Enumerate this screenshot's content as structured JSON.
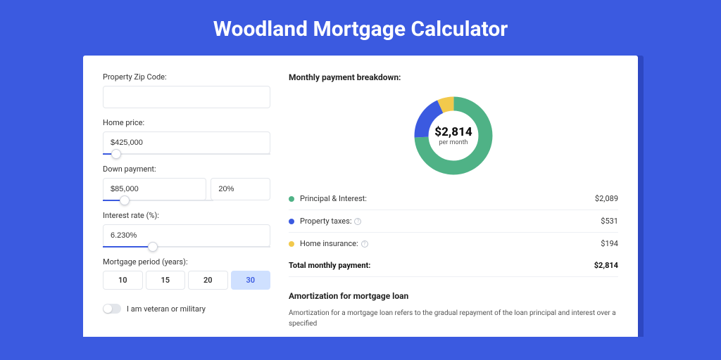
{
  "title": "Woodland Mortgage Calculator",
  "form": {
    "zip": {
      "label": "Property Zip Code:",
      "value": ""
    },
    "homePrice": {
      "label": "Home price:",
      "value": "$425,000",
      "sliderPct": 8
    },
    "downPayment": {
      "label": "Down payment:",
      "amount": "$85,000",
      "percent": "20%",
      "sliderPct": 20
    },
    "interestRate": {
      "label": "Interest rate (%):",
      "value": "6.230%",
      "sliderPct": 30
    },
    "mortgagePeriod": {
      "label": "Mortgage period (years):",
      "options": [
        "10",
        "15",
        "20",
        "30"
      ],
      "selected": "30"
    },
    "veteran": {
      "label": "I am veteran or military",
      "on": false
    }
  },
  "breakdown": {
    "title": "Monthly payment breakdown:",
    "amount": "$2,814",
    "sub": "per month",
    "items": [
      {
        "label": "Principal & Interest:",
        "value": "$2,089",
        "color": "#4fb286",
        "help": false
      },
      {
        "label": "Property taxes:",
        "value": "$531",
        "color": "#3b5ae0",
        "help": true
      },
      {
        "label": "Home insurance:",
        "value": "$194",
        "color": "#f2c94c",
        "help": true
      }
    ],
    "totalLabel": "Total monthly payment:",
    "totalValue": "$2,814"
  },
  "amortization": {
    "title": "Amortization for mortgage loan",
    "body": "Amortization for a mortgage loan refers to the gradual repayment of the loan principal and interest over a specified"
  },
  "chart_data": {
    "type": "pie",
    "title": "Monthly payment breakdown",
    "categories": [
      "Principal & Interest",
      "Property taxes",
      "Home insurance"
    ],
    "values": [
      2089,
      531,
      194
    ],
    "colors": [
      "#4fb286",
      "#3b5ae0",
      "#f2c94c"
    ],
    "total": 2814,
    "center_label": "$2,814 per month"
  }
}
